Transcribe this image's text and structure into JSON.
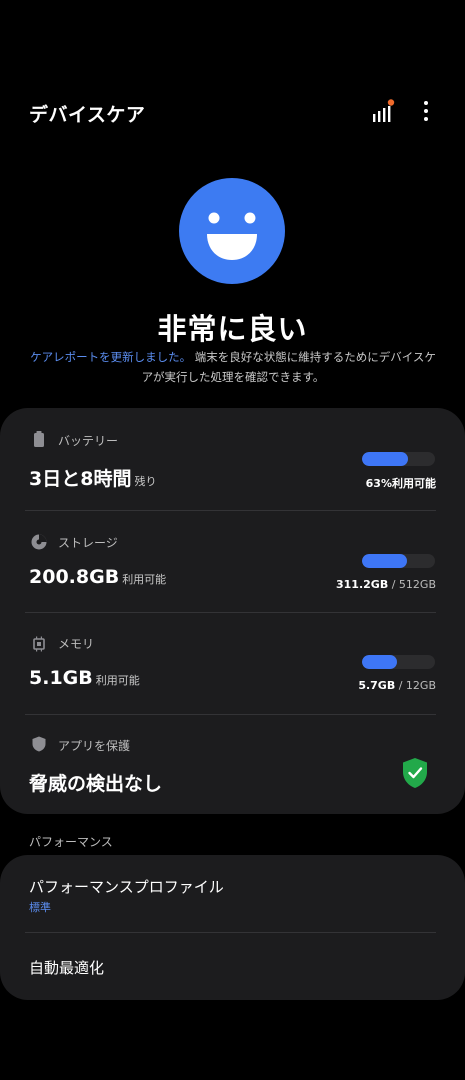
{
  "header": {
    "title": "デバイスケア"
  },
  "status": {
    "title": "非常に良い",
    "link_text": "ケアレポートを更新しました。",
    "description": "端末を良好な状態に維持するためにデバイスケアが実行した処理を確認できます。"
  },
  "battery": {
    "label": "バッテリー",
    "value": "3日と8時間",
    "unit": "残り",
    "percent_available": 63,
    "caption": "63%利用可能"
  },
  "storage": {
    "label": "ストレージ",
    "value": "200.8GB",
    "unit": "利用可能",
    "used": "311.2GB",
    "total": "512GB",
    "fill_fraction": 0.61
  },
  "memory": {
    "label": "メモリ",
    "value": "5.1GB",
    "unit": "利用可能",
    "used": "5.7GB",
    "total": "12GB",
    "fill_fraction": 0.475
  },
  "app_protection": {
    "label": "アプリを保護",
    "value": "脅威の検出なし"
  },
  "performance": {
    "section_title": "パフォーマンス",
    "profile_title": "パフォーマンスプロファイル",
    "profile_value": "標準",
    "auto_optimize": "自動最適化"
  },
  "colors": {
    "accent": "#3e76f6",
    "link": "#5b8def",
    "face": "#3d7bf2",
    "shield": "#22a94a",
    "notification_dot": "#f06b2c",
    "card": "#1c1c1e"
  }
}
